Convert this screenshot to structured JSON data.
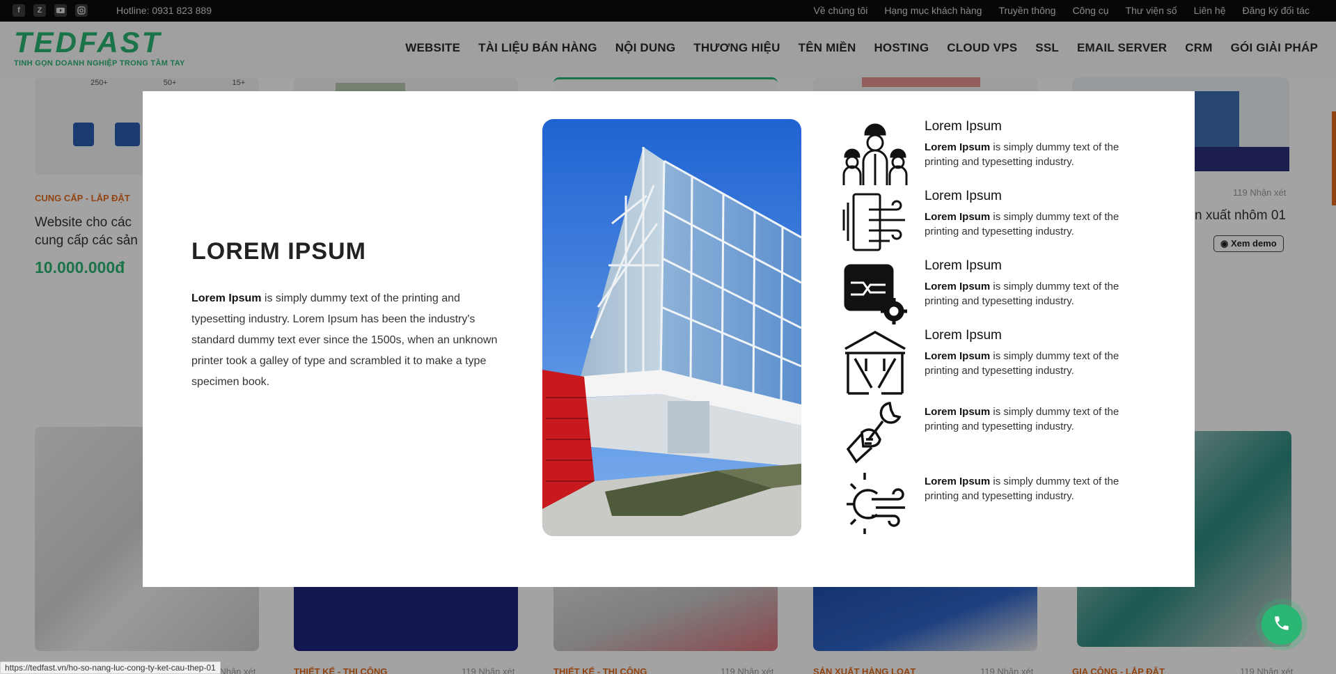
{
  "topbar": {
    "socials": [
      "facebook-icon",
      "zalo-icon",
      "youtube-icon",
      "instagram-icon"
    ],
    "hotline": "Hotline: 0931 823 889",
    "links": [
      "Về chúng tôi",
      "Hạng mục khách hàng",
      "Truyền thông",
      "Công cụ",
      "Thư viện số",
      "Liên hệ",
      "Đăng ký đối tác"
    ]
  },
  "header": {
    "logo_text": "TEDFAST",
    "logo_tagline": "TINH GỌN DOANH NGHIỆP TRONG TẦM TAY",
    "nav": [
      "WEBSITE",
      "TÀI LIỆU BÁN HÀNG",
      "NỘI DUNG",
      "THƯƠNG HIỆU",
      "TÊN MIỀN",
      "HOSTING",
      "CLOUD VPS",
      "SSL",
      "EMAIL SERVER",
      "CRM",
      "GÓI GIẢI PHÁP"
    ]
  },
  "background": {
    "card1": {
      "category": "CUNG CẤP - LẮP ĐẶT",
      "title_line1": "Website cho các",
      "title_line2": "cung cấp các sản",
      "price": "10.000.000đ",
      "stats": [
        "250+",
        "50+",
        "15+"
      ]
    },
    "card5": {
      "reviews": "119 Nhận xét",
      "title_partial": "n xuất nhôm 01",
      "demo_label": "Xem demo"
    },
    "bottom_cards": [
      {
        "category": "THIẾT KẾ - THI CÔNG",
        "reviews": "119 Nhận xét"
      },
      {
        "category": "THIẾT KẾ - THI CÔNG",
        "reviews": "119 Nhận xét"
      },
      {
        "category": "SẢN XUẤT HÀNG LOẠT",
        "reviews": "119 Nhận xét"
      },
      {
        "category": "GIA CÔNG - LẮP ĐẶT",
        "reviews": "119 Nhận xét"
      }
    ],
    "first_bottom_reviews": "119 Nhận xét"
  },
  "modal": {
    "heading": "LOREM IPSUM",
    "text_bold": "Lorem Ipsum",
    "text_rest": " is simply dummy text of the printing and typesetting industry. Lorem Ipsum has been the industry's standard dummy text ever since the 1500s, when an unknown printer took a galley of type and scrambled it to make a type specimen book.",
    "features": [
      {
        "icon": "workers-icon",
        "title": "Lorem Ipsum",
        "desc_bold": "Lorem Ipsum",
        "desc_rest": " is simply dummy text of the printing and typesetting industry."
      },
      {
        "icon": "air-curtain-icon",
        "title": "Lorem Ipsum",
        "desc_bold": "Lorem Ipsum",
        "desc_rest": " is simply dummy text of the printing and typesetting industry."
      },
      {
        "icon": "chip-gear-icon",
        "title": "Lorem Ipsum",
        "desc_bold": "Lorem Ipsum",
        "desc_rest": " is simply dummy text of the printing and typesetting industry."
      },
      {
        "icon": "steel-frame-icon",
        "title": "Lorem Ipsum",
        "desc_bold": "Lorem Ipsum",
        "desc_rest": " is simply dummy text of the printing and typesetting industry."
      },
      {
        "icon": "wrench-hand-icon",
        "title": "",
        "desc_bold": "Lorem Ipsum",
        "desc_rest": " is simply dummy text of the printing and typesetting industry."
      },
      {
        "icon": "sun-wind-icon",
        "title": "",
        "desc_bold": "Lorem Ipsum",
        "desc_rest": " is simply dummy text of the printing and typesetting industry."
      }
    ]
  },
  "status_url": "https://tedfast.vn/ho-so-nang-luc-cong-ty-ket-cau-thep-01",
  "colors": {
    "brand_green": "#2bb673",
    "category_orange": "#e36b1b",
    "topbar_bg": "#0b0b0b"
  }
}
